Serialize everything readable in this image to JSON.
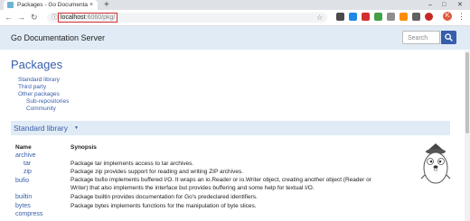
{
  "browser": {
    "tab_title": "Packages - Go Documentation",
    "new_tab": "+",
    "url_host": "localhost",
    "url_path": ":6060/pkg/",
    "avatar_letter": "K"
  },
  "header": {
    "site_title": "Go Documentation Server",
    "search_placeholder": "Search"
  },
  "main": {
    "title": "Packages",
    "toc": [
      "Standard library",
      "Third party",
      "Other packages",
      "Sub-repositories",
      "Community"
    ],
    "section_title": "Standard library",
    "columns": {
      "name": "Name",
      "synopsis": "Synopsis"
    },
    "packages": [
      {
        "name": "archive",
        "synopsis": ""
      },
      {
        "name": "tar",
        "synopsis": "Package tar implements access to tar archives."
      },
      {
        "name": "zip",
        "synopsis": "Package zip provides support for reading and writing ZIP archives."
      },
      {
        "name": "bufio",
        "synopsis": "Package bufio implements buffered I/O. It wraps an io.Reader or io.Writer object, creating another object (Reader or"
      },
      {
        "name": "",
        "synopsis": "Writer) that also implements the interface but provides buffering and some help for textual I/O."
      },
      {
        "name": "builtin",
        "synopsis": "Package builtin provides documentation for Go's predeclared identifiers."
      },
      {
        "name": "bytes",
        "synopsis": "Package bytes implements functions for the manipulation of byte slices."
      },
      {
        "name": "compress",
        "synopsis": ""
      }
    ]
  },
  "colors": {
    "accent": "#375eab",
    "header_bg": "#e0ebf5"
  }
}
